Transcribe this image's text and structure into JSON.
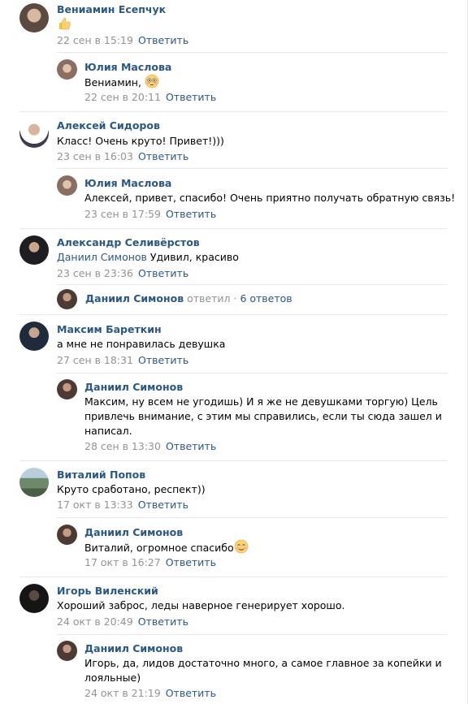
{
  "reply_label": "Ответить",
  "colors": {
    "link": "#2a5885",
    "meta": "#939393",
    "separator": "#e7e8ec"
  },
  "comments": [
    {
      "author": "Вениамин Есепчук",
      "text": "",
      "emoji": "thumbs-up",
      "date": "22 сен в 15:19",
      "replies": [
        {
          "author": "Юлия Маслова",
          "text": "Вениамин,",
          "emoji": "flushed-face",
          "date": "22 сен в 20:11"
        }
      ]
    },
    {
      "author": "Алексей Сидоров",
      "text": "Класс! Очень круто! Привет!)))",
      "date": "23 сен в 16:03",
      "replies": [
        {
          "author": "Юлия Маслова",
          "text": "Алексей, привет, спасибо! Очень приятно получать обратную связь!",
          "date": "23 сен в 17:59"
        }
      ]
    },
    {
      "author": "Александр Селивёрстов",
      "mention": "Даниил Симонов",
      "text": "Удивил, красиво",
      "date": "23 сен в 23:36",
      "thread": {
        "author": "Даниил Симонов",
        "action": "ответил",
        "sep": "·",
        "count": "6 ответов"
      }
    },
    {
      "author": "Максим Бареткин",
      "text": "а мне не понравилась девушка",
      "date": "27 сен в 18:31",
      "replies": [
        {
          "author": "Даниил Симонов",
          "lines": [
            "Максим, ну всем не угодишь) И я же не девушками торгую) Цель",
            "привлечь внимание, с этим мы справились, если ты сюда зашел и",
            "написал."
          ],
          "date": "28 сен в 13:30"
        }
      ]
    },
    {
      "author": "Виталий Попов",
      "text": "Круто сработано, респект))",
      "date": "17 окт в 13:33",
      "replies": [
        {
          "author": "Даниил Симонов",
          "text": "Виталий, огромное спасибо",
          "emoji": "smiling-face",
          "date": "17 окт в 16:27"
        }
      ]
    },
    {
      "author": "Игорь Виленский",
      "text": "Хороший заброс, леды наверное генерирует хорошо.",
      "date": "24 окт в 20:49",
      "replies": [
        {
          "author": "Даниил Симонов",
          "lines": [
            "Игорь, да, лидов достаточно много, а самое главное за копейки и",
            "лояльные)"
          ],
          "date": "24 окт в 21:19"
        }
      ]
    }
  ]
}
